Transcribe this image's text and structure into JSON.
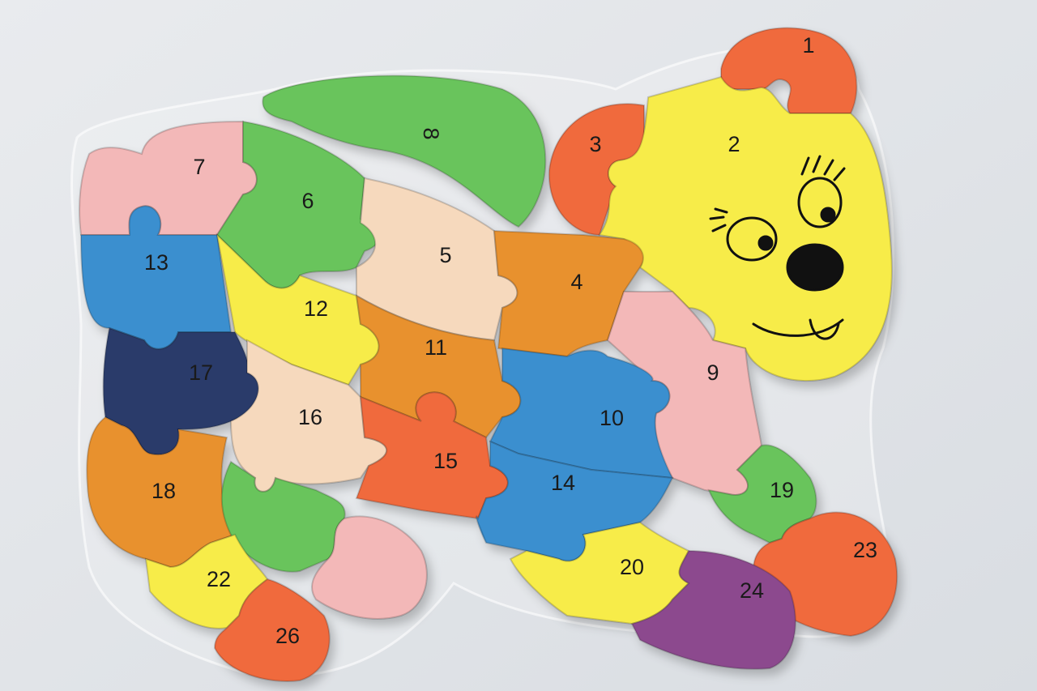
{
  "puzzle": {
    "pieces": [
      {
        "label": "1",
        "color": "#f06a3e"
      },
      {
        "label": "2",
        "color": "#f7ec4a"
      },
      {
        "label": "3",
        "color": "#f06a3e"
      },
      {
        "label": "4",
        "color": "#e8912f"
      },
      {
        "label": "5",
        "color": "#f6d9bd"
      },
      {
        "label": "6",
        "color": "#69c45c"
      },
      {
        "label": "7",
        "color": "#f3b8b8"
      },
      {
        "label": "8",
        "color": "#69c45c"
      },
      {
        "label": "9",
        "color": "#f3b8b8"
      },
      {
        "label": "10",
        "color": "#3b8fcf"
      },
      {
        "label": "11",
        "color": "#e8912f"
      },
      {
        "label": "12",
        "color": "#f7ec4a"
      },
      {
        "label": "13",
        "color": "#3b8fcf"
      },
      {
        "label": "14",
        "color": "#3b8fcf"
      },
      {
        "label": "15",
        "color": "#f06a3e"
      },
      {
        "label": "16",
        "color": "#f6d9bd"
      },
      {
        "label": "17",
        "color": "#2a3b6b"
      },
      {
        "label": "18",
        "color": "#e8912f"
      },
      {
        "label": "19",
        "color": "#69c45c"
      },
      {
        "label": "20",
        "color": "#f7ec4a"
      },
      {
        "label": "22",
        "color": "#f7ec4a"
      },
      {
        "label": "23",
        "color": "#f06a3e"
      },
      {
        "label": "24",
        "color": "#8c4a8e"
      },
      {
        "label": "26",
        "color": "#f06a3e"
      }
    ]
  }
}
